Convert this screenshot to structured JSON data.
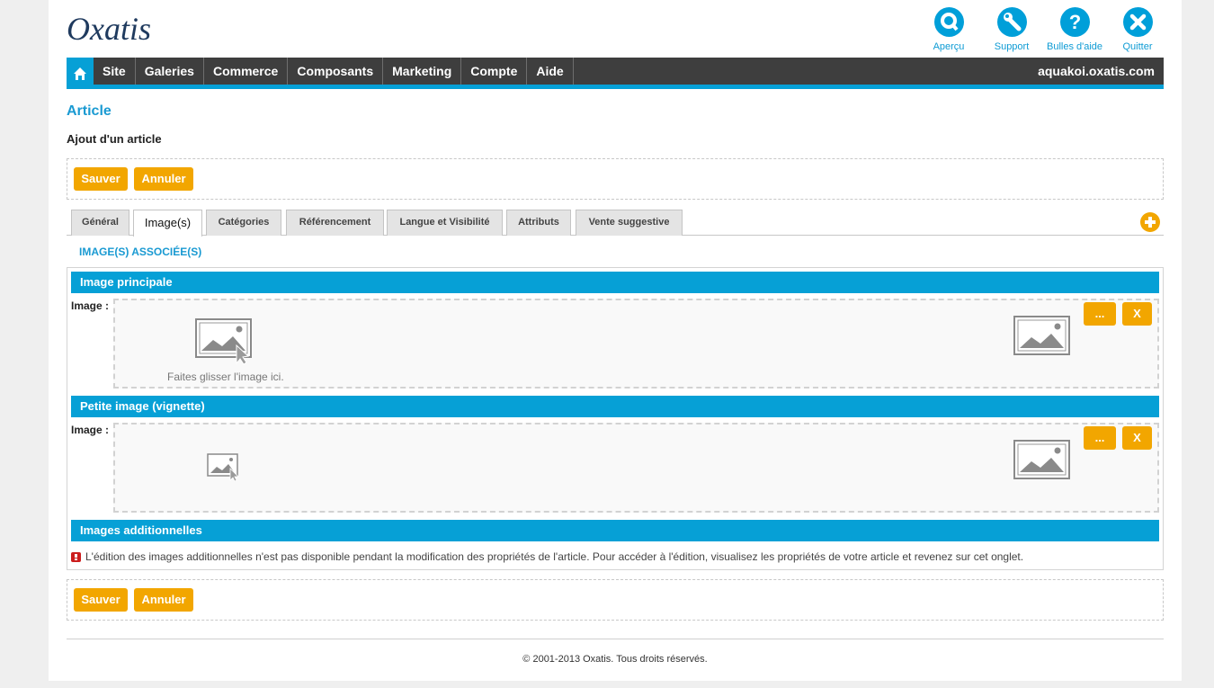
{
  "brand": {
    "logo_text": "Oxatis"
  },
  "top_icons": [
    {
      "label": "Aperçu",
      "icon": "preview-icon"
    },
    {
      "label": "Support",
      "icon": "wrench-icon"
    },
    {
      "label": "Bulles d'aide",
      "icon": "help-icon"
    },
    {
      "label": "Quitter",
      "icon": "close-icon"
    }
  ],
  "nav": {
    "items": [
      "Site",
      "Galeries",
      "Commerce",
      "Composants",
      "Marketing",
      "Compte",
      "Aide"
    ],
    "domain": "aquakoi.oxatis.com"
  },
  "page": {
    "title": "Article",
    "subtitle": "Ajout d'un article"
  },
  "actions": {
    "save": "Sauver",
    "cancel": "Annuler"
  },
  "tabs": [
    "Général",
    "Image(s)",
    "Catégories",
    "Référencement",
    "Langue et Visibilité",
    "Attributs",
    "Vente suggestive"
  ],
  "active_tab": "Image(s)",
  "section_title": "IMAGE(S) ASSOCIÉE(S)",
  "main_image": {
    "header": "Image principale",
    "label": "Image :",
    "drop_hint": "Faites glisser l'image ici.",
    "browse_label": "...",
    "remove_label": "X"
  },
  "thumb_image": {
    "header": "Petite image (vignette)",
    "label": "Image :",
    "browse_label": "...",
    "remove_label": "X"
  },
  "additional": {
    "header": "Images additionnelles",
    "notice": "L'édition des images additionnelles n'est pas disponible pendant la modification des propriétés de l'article. Pour accéder à l'édition, visualisez les propriétés de votre article et revenez sur cet onglet."
  },
  "footer": {
    "copyright": "© 2001-2013 Oxatis. Tous droits réservés."
  },
  "colors": {
    "accent_blue": "#06a0d6",
    "nav_dark": "#3e3e3e",
    "button_orange": "#f2a600"
  }
}
